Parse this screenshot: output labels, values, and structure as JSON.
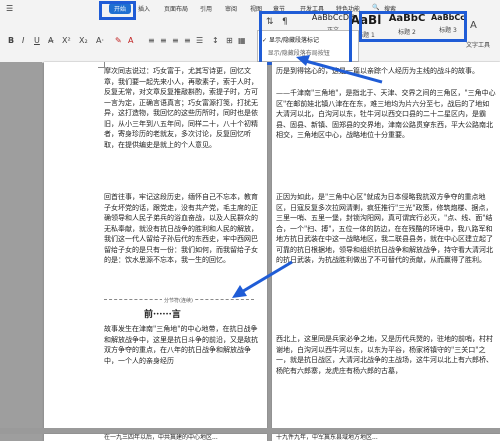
{
  "ribbon": {
    "tabs": [
      "开始",
      "插入",
      "页面布局",
      "引用",
      "审阅",
      "视图",
      "章节",
      "开发工具",
      "特色功能",
      "搜索"
    ],
    "styles": [
      {
        "sample": "AaBbCcDd",
        "label": "正文"
      },
      {
        "sample": "AaBl",
        "label": "标题 1"
      },
      {
        "sample": "AaBbC",
        "label": "标题 2"
      },
      {
        "sample": "AaBbCc",
        "label": "标题 3"
      }
    ],
    "text_tool_label": "文字工具",
    "find_replace_label": "查找替换"
  },
  "popup": {
    "item1": "显示/隐藏段落标记",
    "item2": "显示/隐藏段落布局按钮"
  },
  "doc": {
    "left_para1": "摩次同志说过：巧女富于，尤其写诗更，回忆文章，我们要一起先来小人，再歌素子，索于人时，反复无常，对文章反复推敲斟酌，索提子时，方可一言为定，正确言语真言；巧女富源打笺，打扰无异，这打造物，我回忆的这些历所时，同时也是依旧，从小三年到八五年间，同样二十，八十个初精者，寄身珍历的老就友，多次讨论，反复回忆听取，在提供编史是就上的个人意见。",
    "left_para2": "回首往事，牢记这段历史，缅怀自己不忘本，教育子女坏党的话，跟党走，没有共产党，毛主席的正确领导和人民子弟兵的浴血奋战，以及人民群众的无私奉献，就没有抗日战争的胜利和人民的解放，我们这一代人留给子孙后代的东西史，牢中西网巴留给子女的是只有一份：我们如何，而我留给子女的是：饮水思源不忘本，我一生的回忆。",
    "section_label": "分节符(连续)",
    "left_title": "前······言",
    "left_para3": "故事发生在津南\"三角地\"的中心地带，在抗日战争和解放战争中，这里是抗日斗争的前沿，又是敌抗双方争夺的重点，在八年的抗日战争和解放战争中，一个人的亲身经历",
    "right_para1": "历是到得铭心的，这是一篇以亲踪个人经历为主线的战斗的故事。",
    "right_para2": "——千津南\"三角地\"，是指北于、天津、交界之间的三角区，\"三角中心区\"在邮前娃北镇八津在在东，难三地均为片六分至七，战后的了地如大清河以北，白沟河以东，牡牛河以西交口县的二十二星区内，是霸县、固县、新镇、固郑县的交界地，津南公路贯穿东西，平大公路南北相交，三角地区中心，战略地位十分重要。",
    "right_para3": "正因为如此，是\"三角中心区\"就成为日本侵略我抗双方争夺的重点地区，日寇反复多次拉网清剿，疯狂推行\"三光\"政策，修筑炮楼、据点，三里一哨、五里一堡，封锁沟阳网，真可谓宾行必灭，\"点、线、面\"结合，一个\"扫、搏\"，五位一体的防边，在在残酷的环境中，我八路军和地方抗日武装在中这一战略地区，我二联县县务，就在中心区建立起了可靠的抗日根据地，领导和组织抗日战争和解放战争，持守看大清河北的抗日武装，为抗战胜利做出了不可替代的贡献，从而赢得了胜利。",
    "right_para4": "西北上，这里同是兵家必争之地，又是历代兵燹的，驻地的前哨，村村谢地，白沟河以西牛河以东，以东为平谷，杨家将镇守的\"三关口\"之一，就是抗日战区，大清河北战争的主战场，这牛河以北上有六郎桥、杨陀有六郎寨，龙虎庄有杨六郎的古墓，",
    "bottom_left": "在一九三四年以后，中共冀建的中心地区...",
    "bottom_right": "十九件九年，中军冀东县域地方地区..."
  }
}
